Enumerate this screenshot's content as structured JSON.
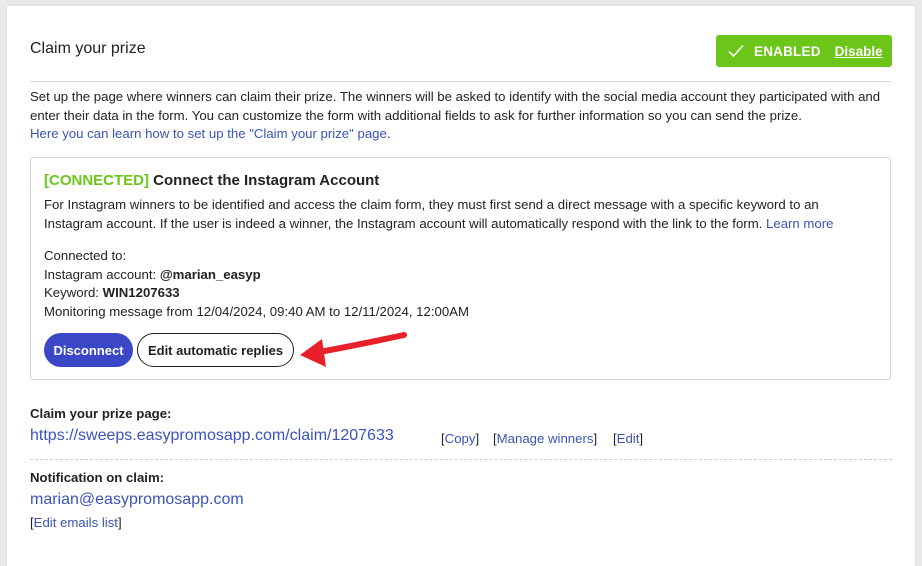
{
  "header": {
    "title": "Claim your prize",
    "status_label": "ENABLED",
    "disable_label": "Disable"
  },
  "intro": {
    "text": "Set up the page where winners can claim their prize. The winners will be asked to identify with the social media account they participated with and enter their data in the form. You can customize the form with additional fields to ask for further information so you can send the prize.",
    "learn_link": "Here you can learn how to set up the \"Claim your prize\" page"
  },
  "instagram": {
    "connected_tag": "[CONNECTED]",
    "title": "Connect the Instagram Account",
    "description": "For Instagram winners to be identified and access the claim form, they must first send a direct message with a specific keyword to an Instagram account. If the user is indeed a winner, the Instagram account will automatically respond with the link to the form.",
    "learn_more": "Learn more",
    "connected_to_label": "Connected to:",
    "account_label": "Instagram account:",
    "account_value": "@marian_easyp",
    "keyword_label": "Keyword:",
    "keyword_value": "WIN1207633",
    "monitoring_text": "Monitoring message from 12/04/2024, 09:40 AM to 12/11/2024, 12:00AM",
    "disconnect_label": "Disconnect",
    "edit_replies_label": "Edit automatic replies"
  },
  "claim_page": {
    "label": "Claim your prize page:",
    "url": "https://sweeps.easypromosapp.com/claim/1207633",
    "copy_label": "Copy",
    "manage_label": "Manage winners",
    "edit_label": "Edit"
  },
  "notification": {
    "label": "Notification on claim:",
    "email": "marian@easypromosapp.com",
    "edit_emails_label": "Edit emails list"
  },
  "colors": {
    "accent_green": "#6cc619",
    "primary_blue": "#3b47c6",
    "link_blue": "#3a54b9",
    "arrow_red": "#e8202a"
  }
}
